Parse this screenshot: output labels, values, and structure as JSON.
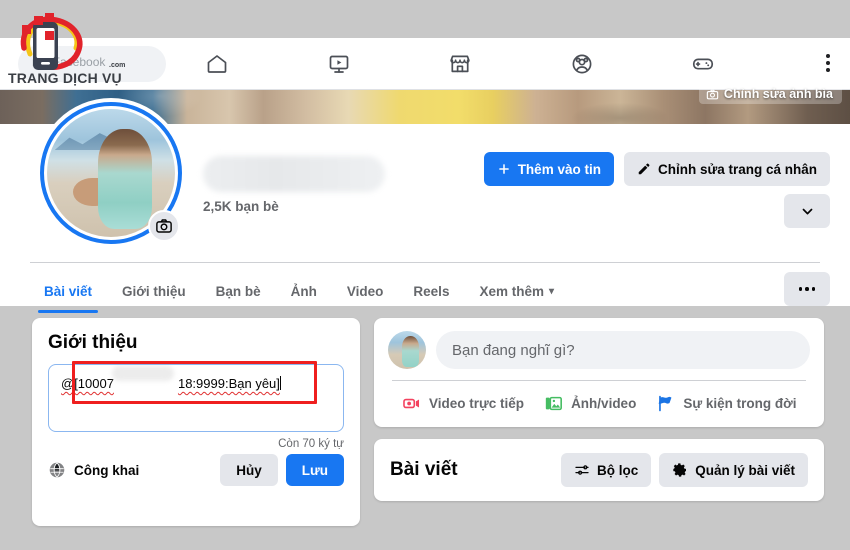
{
  "browser": {
    "search_text": "rên Facebook",
    "menu_icon": "kebab-menu-icon"
  },
  "nav": {
    "items": [
      {
        "name": "home-icon",
        "label": "Trang chủ"
      },
      {
        "name": "watch-video-icon",
        "label": "Video"
      },
      {
        "name": "marketplace-icon",
        "label": "Marketplace"
      },
      {
        "name": "groups-icon",
        "label": "Nhóm"
      },
      {
        "name": "gaming-icon",
        "label": "Chơi game"
      }
    ]
  },
  "cover": {
    "edit_label": "Chỉnh sửa ảnh bìa",
    "edit_icon": "camera-icon"
  },
  "profile": {
    "name": "",
    "name_blurred": true,
    "friend_count": "2,5K bạn bè",
    "avatar_camera_icon": "camera-icon",
    "buttons": {
      "add_story": "Thêm vào tin",
      "add_story_icon": "plus-icon",
      "edit_profile": "Chỉnh sửa trang cá nhân",
      "edit_profile_icon": "pencil-icon",
      "more_icon": "chevron-down-icon"
    }
  },
  "tabs": {
    "items": [
      {
        "label": "Bài viết",
        "active": true
      },
      {
        "label": "Giới thiệu",
        "active": false
      },
      {
        "label": "Bạn bè",
        "active": false
      },
      {
        "label": "Ảnh",
        "active": false
      },
      {
        "label": "Video",
        "active": false
      },
      {
        "label": "Reels",
        "active": false
      },
      {
        "label": "Xem thêm",
        "active": false,
        "caret": "▾"
      }
    ],
    "more_icon": "ellipsis-icon"
  },
  "intro": {
    "title": "Giới thiệu",
    "bio_prefix": "@[10007",
    "bio_suffix": "18:9999:Bạn yêu]",
    "bio_full": "@[10007……18:9999:Bạn yêu]",
    "chars_left": "Còn 70 ký tự",
    "privacy_label": "Công khai",
    "privacy_icon": "globe-icon",
    "cancel_label": "Hủy",
    "save_label": "Lưu",
    "highlight_color": "#ef1f1f"
  },
  "composer": {
    "placeholder": "Bạn đang nghĩ gì?",
    "actions": [
      {
        "label": "Video trực tiếp",
        "icon": "live-video-icon",
        "color": "#f3425f"
      },
      {
        "label": "Ảnh/video",
        "icon": "photo-video-icon",
        "color": "#45bd62"
      },
      {
        "label": "Sự kiện trong đời",
        "icon": "life-event-flag-icon",
        "color": "#1b74e4"
      }
    ]
  },
  "posts": {
    "title": "Bài viết",
    "filter_label": "Bộ lọc",
    "filter_icon": "sliders-icon",
    "manage_label": "Quản lý bài viết",
    "manage_icon": "gear-icon"
  },
  "watermark": {
    "brand": "TRANG DỊCH VỤ",
    "tld": ".com",
    "logo_icon": "phone-logo-icon"
  },
  "colors": {
    "facebook_blue": "#1877f2",
    "page_bg": "#c8c8c8",
    "card_bg": "#ffffff",
    "button_gray": "#e4e6eb",
    "text_secondary": "#65676b",
    "annotation_red": "#ef1f1f"
  }
}
